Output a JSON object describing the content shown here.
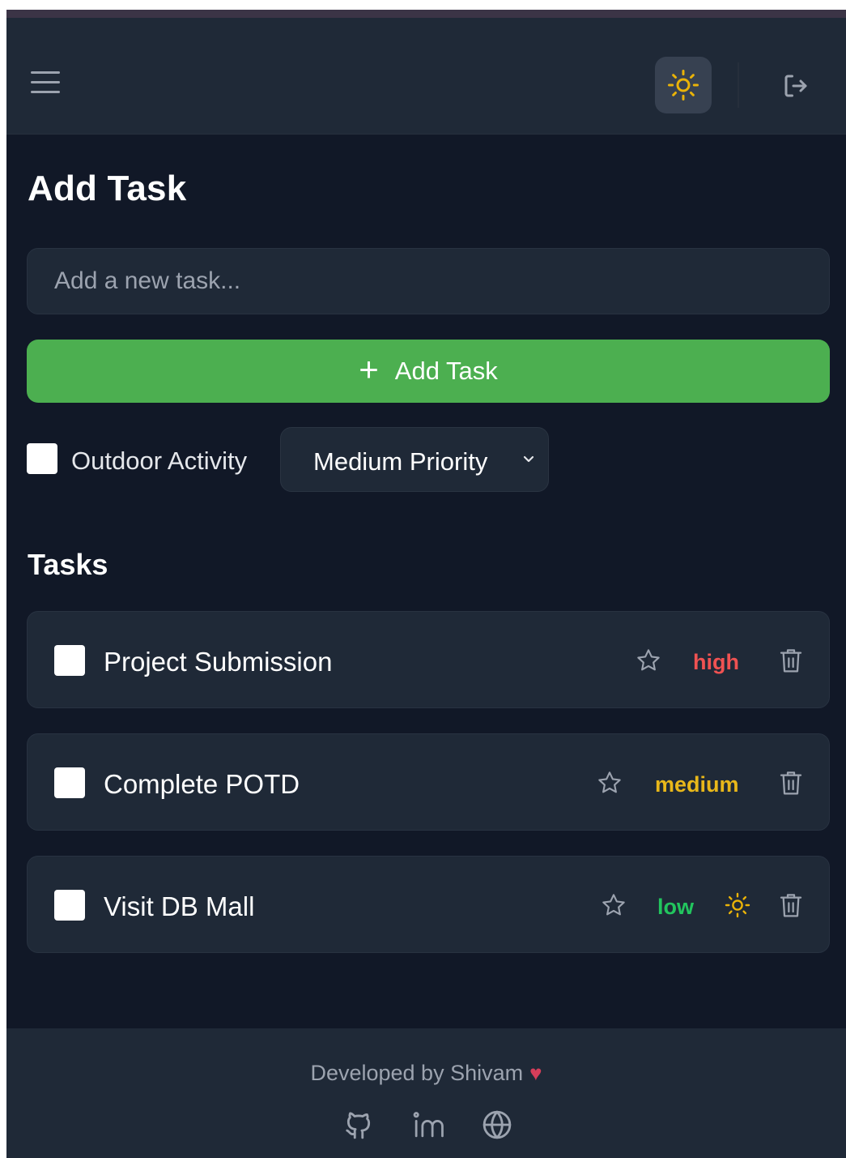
{
  "header": {
    "menu_icon": "hamburger-menu-icon",
    "theme_icon": "sun-icon",
    "logout_icon": "logout-icon",
    "accent_sun": "#eab308"
  },
  "add_section": {
    "title": "Add Task",
    "input_placeholder": "Add a new task...",
    "input_value": "",
    "add_button_label": "Add Task",
    "add_button_color": "#4caf50",
    "outdoor_label": "Outdoor Activity",
    "outdoor_checked": false,
    "priority_selected": "Medium Priority"
  },
  "tasks_section": {
    "title": "Tasks",
    "items": [
      {
        "title": "Project Submission",
        "priority": "high",
        "starred": false,
        "outdoor": false,
        "done": false
      },
      {
        "title": "Complete POTD",
        "priority": "medium",
        "starred": false,
        "outdoor": false,
        "done": false
      },
      {
        "title": "Visit DB Mall",
        "priority": "low",
        "starred": false,
        "outdoor": true,
        "done": false
      }
    ]
  },
  "footer": {
    "credit": "Developed by Shivam",
    "heart_icon": "heart-icon",
    "links": [
      "github-icon",
      "linkedin-icon",
      "globe-icon"
    ]
  }
}
